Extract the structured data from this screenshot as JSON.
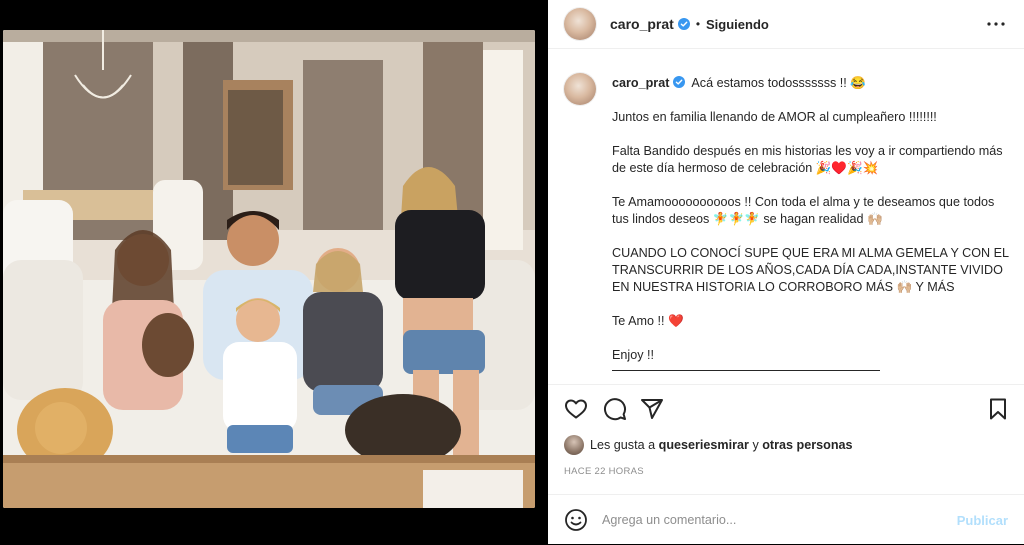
{
  "header": {
    "username": "caro_prat",
    "separator": "•",
    "following_label": "Siguiendo",
    "more_icon": "more-horizontal-icon"
  },
  "caption": {
    "username": "caro_prat",
    "line1": "Acá estamos todosssssss !! 😂",
    "line2": "Juntos en familia llenando de AMOR al cumpleañero !!!!!!!!",
    "line3": "Falta Bandido después en mis historias les voy a ir compartiendo más de este día hermoso de celebración 🎉♥️🎉💥",
    "line4": "Te Amamoooooooooos !! Con toda el alma y te deseamos que todos tus lindos deseos 🧚🧚🧚 se hagan realidad 🙌🏼",
    "line5": "CUANDO LO CONOCÍ SUPE QUE ERA MI ALMA GEMELA Y CON EL TRANSCURRIR DE LOS AÑOS,CADA DÍA CADA,INSTANTE VIVIDO EN NUESTRA HISTORIA LO CORROBORO MÁS 🙌🏼 Y MÁS",
    "line6": "Te Amo !! ❤️",
    "line7": "Enjoy !!"
  },
  "actions": {
    "like_icon": "heart-icon",
    "comment_icon": "comment-icon",
    "share_icon": "send-icon",
    "save_icon": "bookmark-icon"
  },
  "likes": {
    "prefix": "Les gusta a",
    "user": "queseriesmirar",
    "conjunction": "y",
    "others": "otras personas"
  },
  "time": "HACE 22 HORAS",
  "comment": {
    "placeholder": "Agrega un comentario...",
    "publish_label": "Publicar",
    "emoji_icon": "smiley-icon"
  },
  "colors": {
    "verified": "#3897f0",
    "heart": "#ed4956",
    "publish": "#b2dffc"
  }
}
